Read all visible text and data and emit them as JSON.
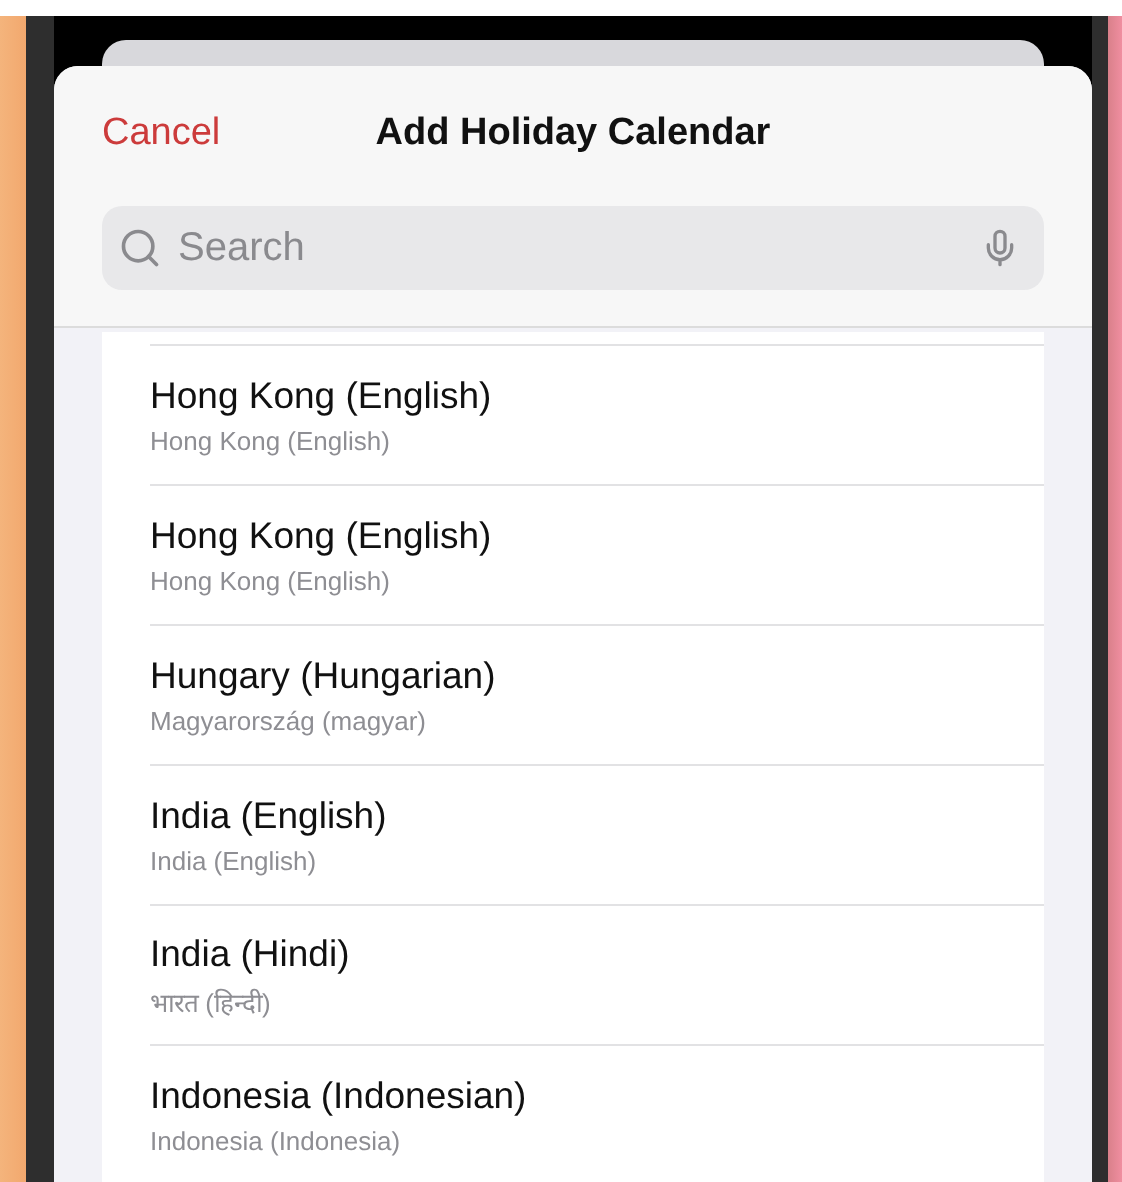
{
  "header": {
    "cancel": "Cancel",
    "title": "Add Holiday Calendar"
  },
  "search": {
    "placeholder": "Search"
  },
  "calendars": [
    {
      "name": "Hong Kong (English)",
      "native": "Hong Kong (English)"
    },
    {
      "name": "Hong Kong (English)",
      "native": "Hong Kong (English)"
    },
    {
      "name": "Hungary (Hungarian)",
      "native": "Magyarország (magyar)"
    },
    {
      "name": "India (English)",
      "native": "India (English)"
    },
    {
      "name": "India (Hindi)",
      "native": "भारत (हिन्दी)"
    },
    {
      "name": "Indonesia (Indonesian)",
      "native": "Indonesia (Indonesia)"
    }
  ]
}
